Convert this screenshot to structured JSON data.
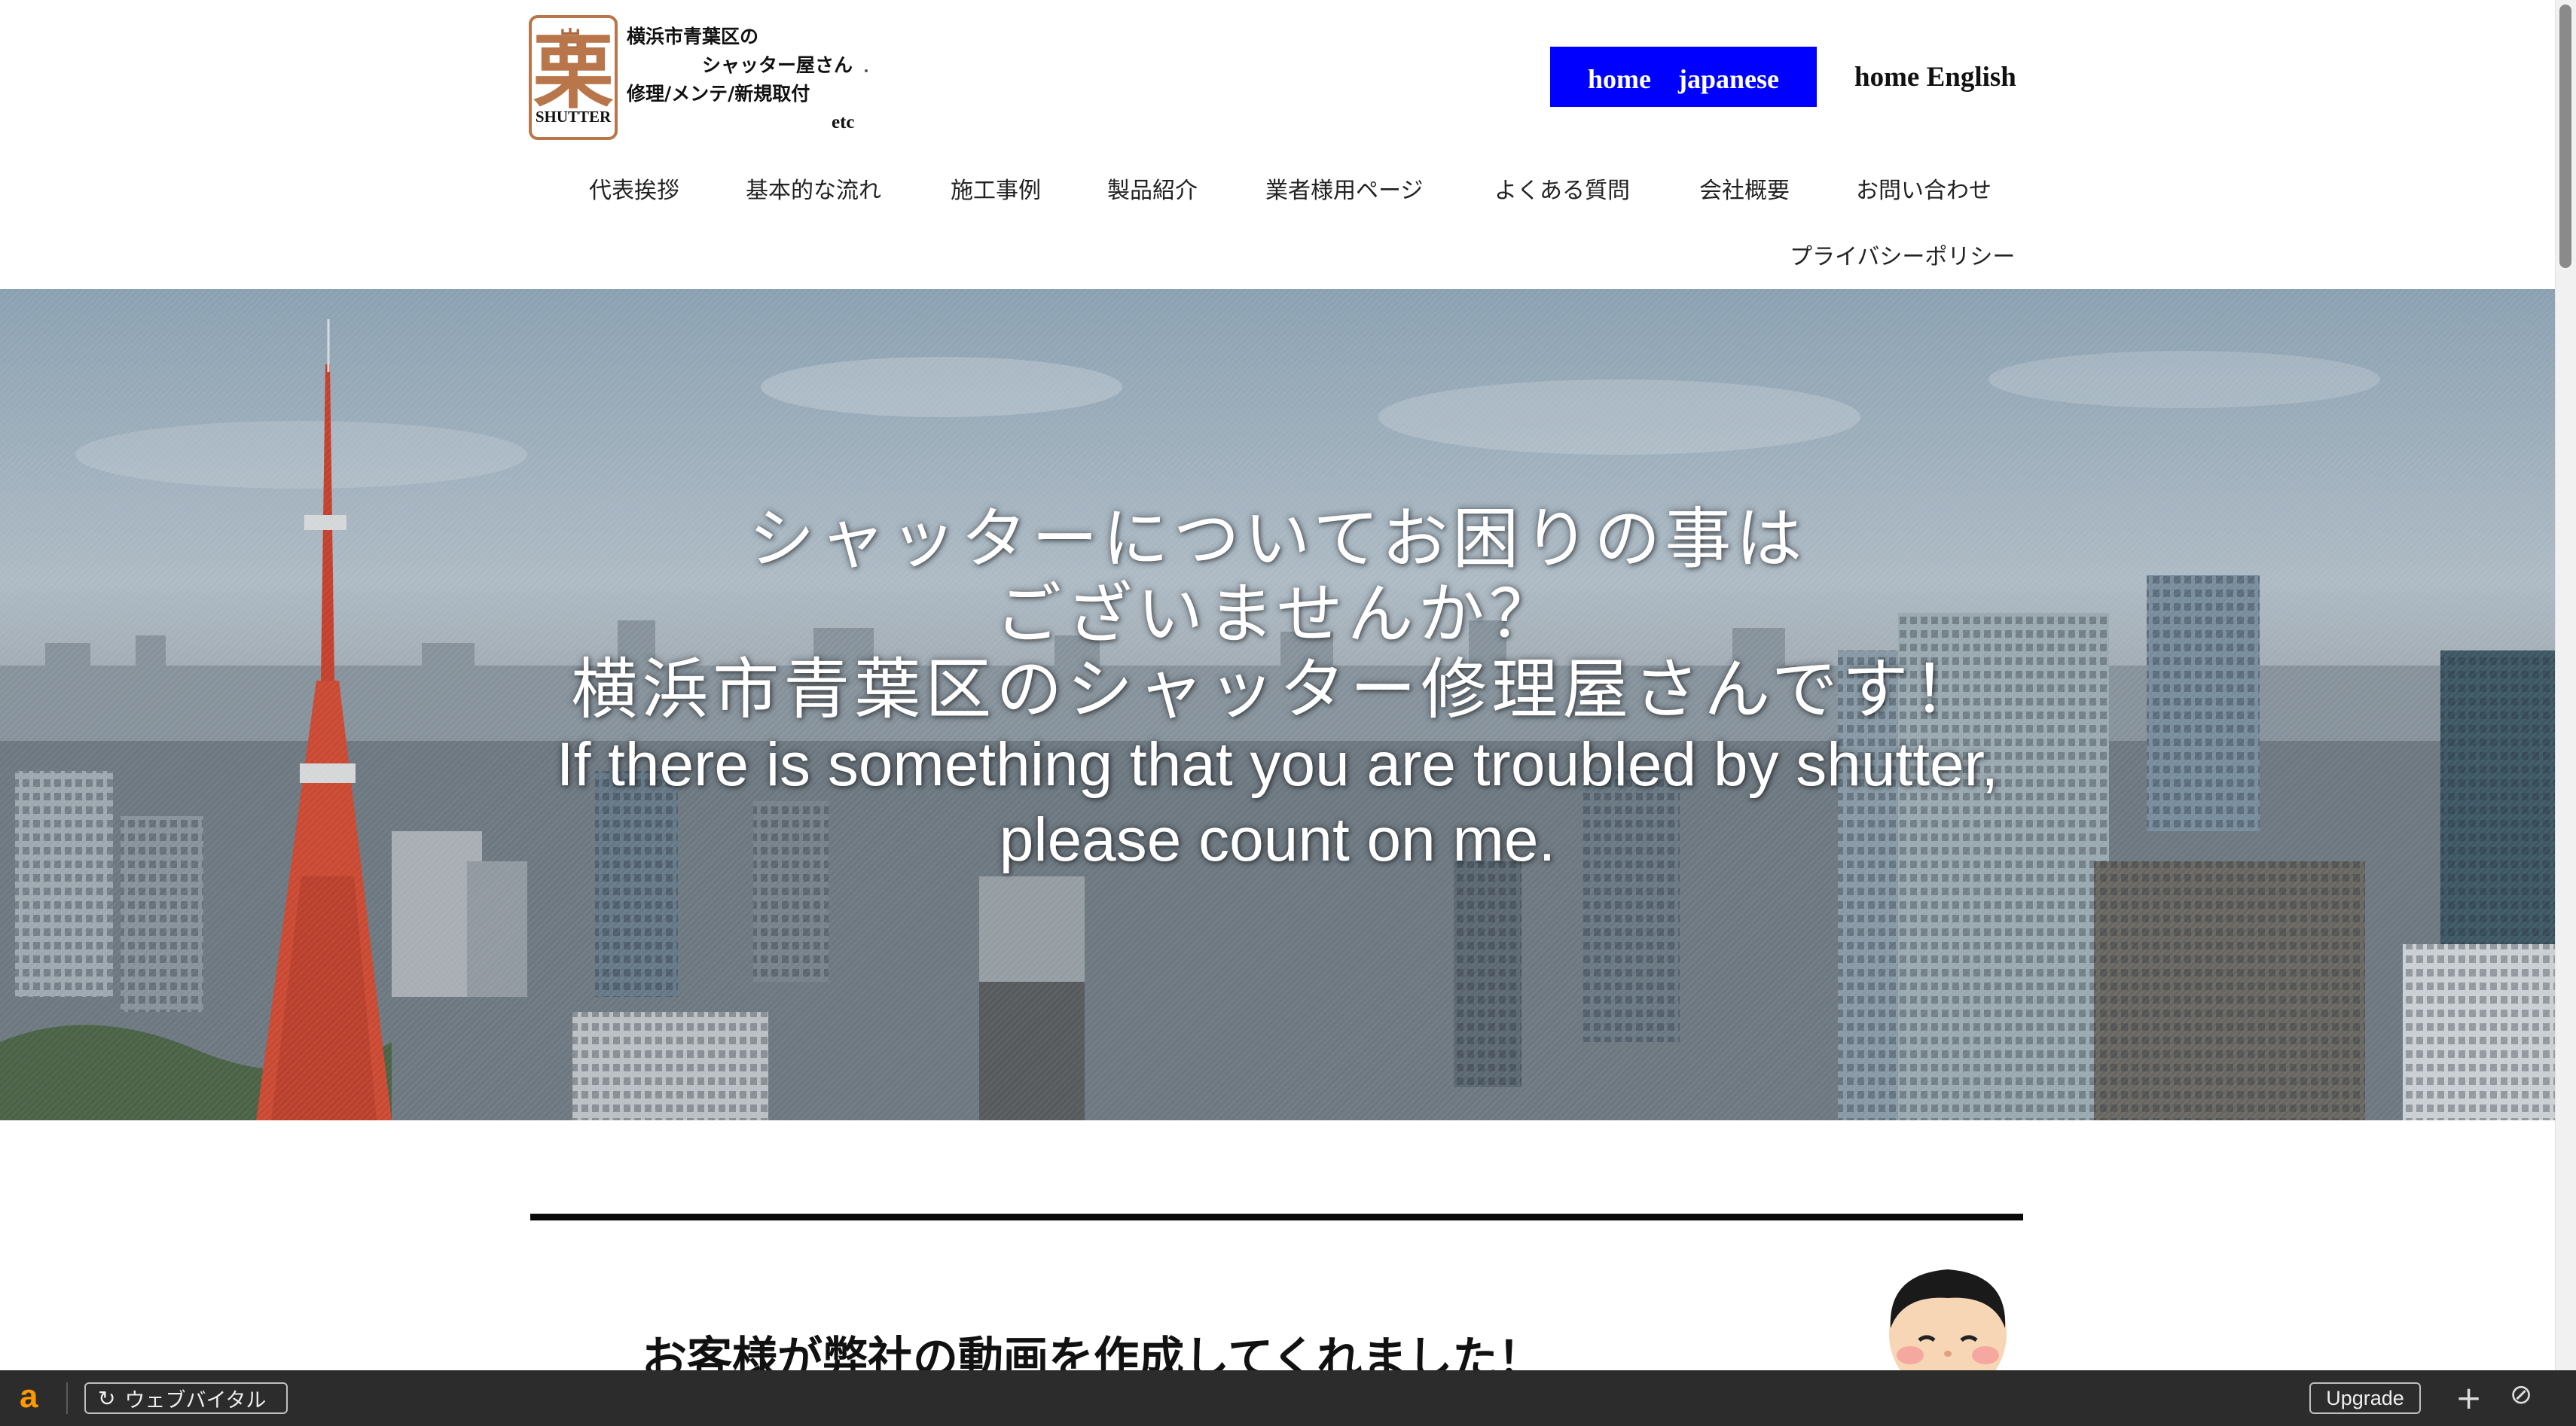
{
  "header": {
    "logo": {
      "small_char": "岩",
      "big_char": "栗",
      "sub_text": "SHUTTER",
      "line1": "横浜市青葉区の",
      "line2": "シャッター屋さん",
      "line3": "修理/メンテ/新規取付",
      "line4": "etc"
    },
    "home_japanese_label": "home　japanese",
    "home_english_label": "home English",
    "nav": [
      {
        "label": "代表挨拶"
      },
      {
        "label": "基本的な流れ"
      },
      {
        "label": "施工事例"
      },
      {
        "label": "製品紹介"
      },
      {
        "label": "業者様用ページ"
      },
      {
        "label": "よくある質問"
      },
      {
        "label": "会社概要"
      },
      {
        "label": "お問い合わせ"
      }
    ],
    "privacy_label": "プライバシーポリシー"
  },
  "hero": {
    "jp_line1": "シャッターについてお困りの事は",
    "jp_line2": "ございませんか？",
    "jp_line3": "横浜市青葉区のシャッター修理屋さんです！",
    "en_line1": "If there is something that you are troubled by shutter,",
    "en_line2": "please count on me."
  },
  "section": {
    "heading": "お客様が弊社の動画を作成してくれました！"
  },
  "toolbar": {
    "logo_char": "a",
    "web_vitals_label": "ウェブバイタル",
    "upgrade_label": "Upgrade",
    "plus_icon": "+",
    "block_icon": "⊘"
  },
  "colors": {
    "home_jp_bg": "#0000ff",
    "logo_accent": "#b8764a",
    "toolbar_bg": "#2c2c2c",
    "toolbar_logo": "#ff9900"
  }
}
